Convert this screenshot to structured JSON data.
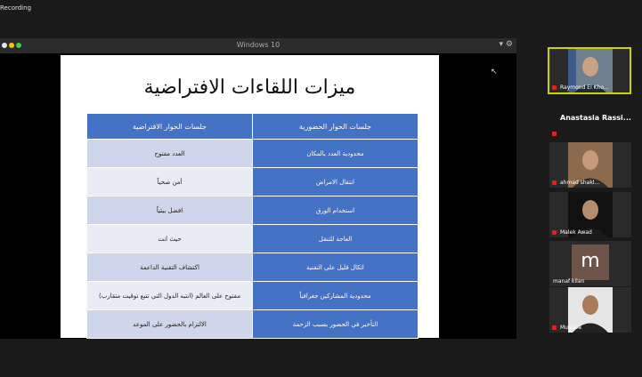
{
  "app": {
    "recording_label": "Recording"
  },
  "share_window": {
    "title": "Windows 10"
  },
  "slide": {
    "title": "ميزات اللقاءات الافتراضية",
    "headers": [
      "جلسات الحوار الحضورية",
      "جلسات الحوار الافتراضية"
    ],
    "rows": [
      [
        "محدودية العدد بالمكان",
        "العدد مفتوح"
      ],
      [
        "انتقال الامراض",
        "أمن صحياً"
      ],
      [
        "استخدام الورق",
        "افضل بيئياً"
      ],
      [
        "العاجة للتنقل",
        "حيث انت"
      ],
      [
        "اتكال قليل على التقنية",
        "اكتشاف التقنية الداعمة"
      ],
      [
        "محدودية المشاركين جغرافياً",
        "مفتوح على العالم (انتبه الدول التي تتبع توقيت متقارب)"
      ],
      [
        "التأخير في الحضور بسبب الزحمة",
        "الالتزام بالحضور على الموعد"
      ]
    ]
  },
  "participants": [
    {
      "name": "Raymond El Kho...",
      "active": true
    },
    {
      "name": "Anastasia Rassi..."
    },
    {
      "name": "ahmad shakl..."
    },
    {
      "name": "Malek Awad"
    },
    {
      "name": "manaf kilan",
      "avatar_letter": "m"
    },
    {
      "name": "Mustafa"
    }
  ]
}
